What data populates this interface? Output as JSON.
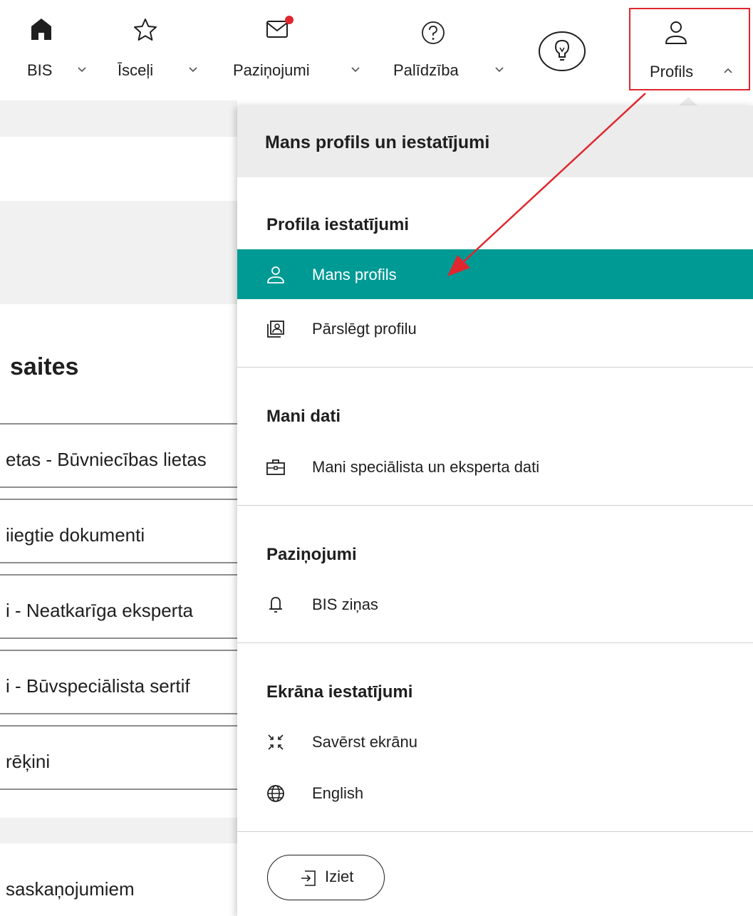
{
  "nav": {
    "items": [
      {
        "label": "BIS",
        "icon": "home-icon"
      },
      {
        "label": "Īsceļi",
        "icon": "star-icon"
      },
      {
        "label": "Paziņojumi",
        "icon": "mail-icon",
        "has_badge": true
      },
      {
        "label": "Palīdzība",
        "icon": "help-icon"
      },
      {
        "label": "Profils",
        "icon": "user-icon"
      }
    ],
    "idea_icon": "lightbulb-icon"
  },
  "background": {
    "heading": "saites",
    "links": [
      "etas - Būvniecības lietas",
      "iiegtie dokumenti",
      "i - Neatkarīga eksperta",
      "i - Būvspeciālista sertif",
      "rēķini",
      "saskaņojumiem"
    ]
  },
  "dropdown": {
    "header": "Mans profils un iestatījumi",
    "sections": [
      {
        "title": "Profila iestatījumi",
        "items": [
          {
            "label": "Mans profils",
            "icon": "user-icon",
            "active": true
          },
          {
            "label": "Pārslēgt profilu",
            "icon": "switch-profile-icon",
            "active": false
          }
        ]
      },
      {
        "title": "Mani dati",
        "items": [
          {
            "label": "Mani speciālista un eksperta dati",
            "icon": "briefcase-icon",
            "active": false
          }
        ]
      },
      {
        "title": "Paziņojumi",
        "items": [
          {
            "label": "BIS ziņas",
            "icon": "bell-icon",
            "active": false
          }
        ]
      },
      {
        "title": "Ekrāna iestatījumi",
        "items": [
          {
            "label": "Savērst ekrānu",
            "icon": "collapse-screen-icon",
            "active": false
          },
          {
            "label": "English",
            "icon": "globe-icon",
            "active": false
          }
        ]
      }
    ],
    "logout_label": "Iziet"
  },
  "colors": {
    "accent": "#009a95",
    "highlight_box": "#e0262e",
    "badge": "#e0262e"
  }
}
